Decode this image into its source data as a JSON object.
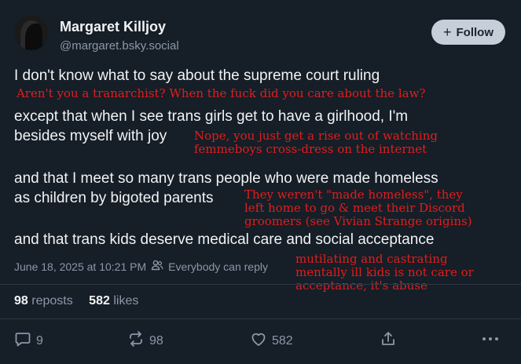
{
  "author": {
    "name": "Margaret Killjoy",
    "handle": "@margaret.bsky.social"
  },
  "follow_label": "Follow",
  "post_lines": [
    "I don't know what to say about the supreme court ruling",
    "except that when I see trans girls get to have a girlhood, I'm",
    "besides myself with joy",
    "and that I meet so many trans people who were made homeless",
    "as children by bigoted parents",
    "and that trans kids deserve medical care and social acceptance"
  ],
  "annotations": {
    "a1": "Aren't you a tranarchist? When the fuck did you care about the law?",
    "a2_l1": "Nope, you just get a rise out of watching",
    "a2_l2": "femmeboys cross-dress on the internet",
    "a3_l1": "They weren't \"made homeless\", they",
    "a3_l2": "left home to go & meet their Discord",
    "a3_l3": "groomers (see Vivian Strange origins)",
    "a4_l1": "mutilating and castrating",
    "a4_l2": "mentally ill kids is not care or",
    "a4_l3": "acceptance, it's abuse"
  },
  "meta": {
    "timestamp": "June 18, 2025 at 10:21 PM",
    "reply_setting": "Everybody can reply"
  },
  "stats": {
    "reposts_count": "98",
    "reposts_label": "reposts",
    "likes_count": "582",
    "likes_label": "likes"
  },
  "actions": {
    "replies": "9",
    "reposts": "98",
    "likes": "582"
  },
  "icons": [
    "reply-icon",
    "repost-icon",
    "like-icon",
    "share-icon",
    "more-icon",
    "people-icon"
  ],
  "colors": {
    "background": "#161e27",
    "annotation": "#e21d1d",
    "muted": "#8b98a9"
  }
}
